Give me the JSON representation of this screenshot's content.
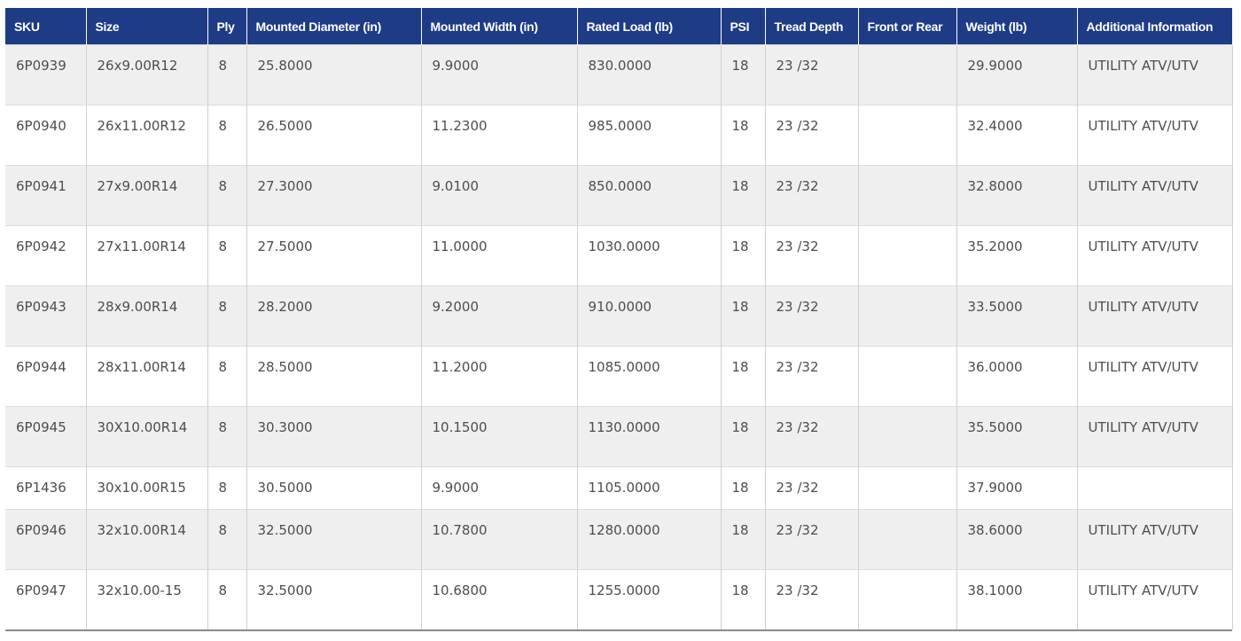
{
  "table": {
    "headers": [
      "SKU",
      "Size",
      "Ply",
      "Mounted Diameter (in)",
      "Mounted Width (in)",
      "Rated Load (lb)",
      "PSI",
      "Tread Depth",
      "Front or Rear",
      "Weight (lb)",
      "Additional Information"
    ],
    "rows": [
      [
        "6P0939",
        "26x9.00R12",
        "8",
        "25.8000",
        "9.9000",
        "830.0000",
        "18",
        "23 /32",
        "",
        "29.9000",
        "UTILITY ATV/UTV"
      ],
      [
        "6P0940",
        "26x11.00R12",
        "8",
        "26.5000",
        "11.2300",
        "985.0000",
        "18",
        "23 /32",
        "",
        "32.4000",
        "UTILITY ATV/UTV"
      ],
      [
        "6P0941",
        "27x9.00R14",
        "8",
        "27.3000",
        "9.0100",
        "850.0000",
        "18",
        "23 /32",
        "",
        "32.8000",
        "UTILITY ATV/UTV"
      ],
      [
        "6P0942",
        "27x11.00R14",
        "8",
        "27.5000",
        "11.0000",
        "1030.0000",
        "18",
        "23 /32",
        "",
        "35.2000",
        "UTILITY ATV/UTV"
      ],
      [
        "6P0943",
        "28x9.00R14",
        "8",
        "28.2000",
        "9.2000",
        "910.0000",
        "18",
        "23 /32",
        "",
        "33.5000",
        "UTILITY ATV/UTV"
      ],
      [
        "6P0944",
        "28x11.00R14",
        "8",
        "28.5000",
        "11.2000",
        "1085.0000",
        "18",
        "23 /32",
        "",
        "36.0000",
        "UTILITY ATV/UTV"
      ],
      [
        "6P0945",
        "30X10.00R14",
        "8",
        "30.3000",
        "10.1500",
        "1130.0000",
        "18",
        "23 /32",
        "",
        "35.5000",
        "UTILITY ATV/UTV"
      ],
      [
        "6P1436",
        "30x10.00R15",
        "8",
        "30.5000",
        "9.9000",
        "1105.0000",
        "18",
        "23 /32",
        "",
        "37.9000",
        ""
      ],
      [
        "6P0946",
        "32x10.00R14",
        "8",
        "32.5000",
        "10.7800",
        "1280.0000",
        "18",
        "23 /32",
        "",
        "38.6000",
        "UTILITY ATV/UTV"
      ],
      [
        "6P0947",
        "32x10.00-15",
        "8",
        "32.5000",
        "10.6800",
        "1255.0000",
        "18",
        "23 /32",
        "",
        "38.1000",
        "UTILITY ATV/UTV"
      ]
    ]
  },
  "colors": {
    "header_background": "#1e3b86",
    "header_text": "#ffffff",
    "row_odd": "#efefef",
    "row_even": "#ffffff",
    "cell_text": "#4d4d4d"
  }
}
